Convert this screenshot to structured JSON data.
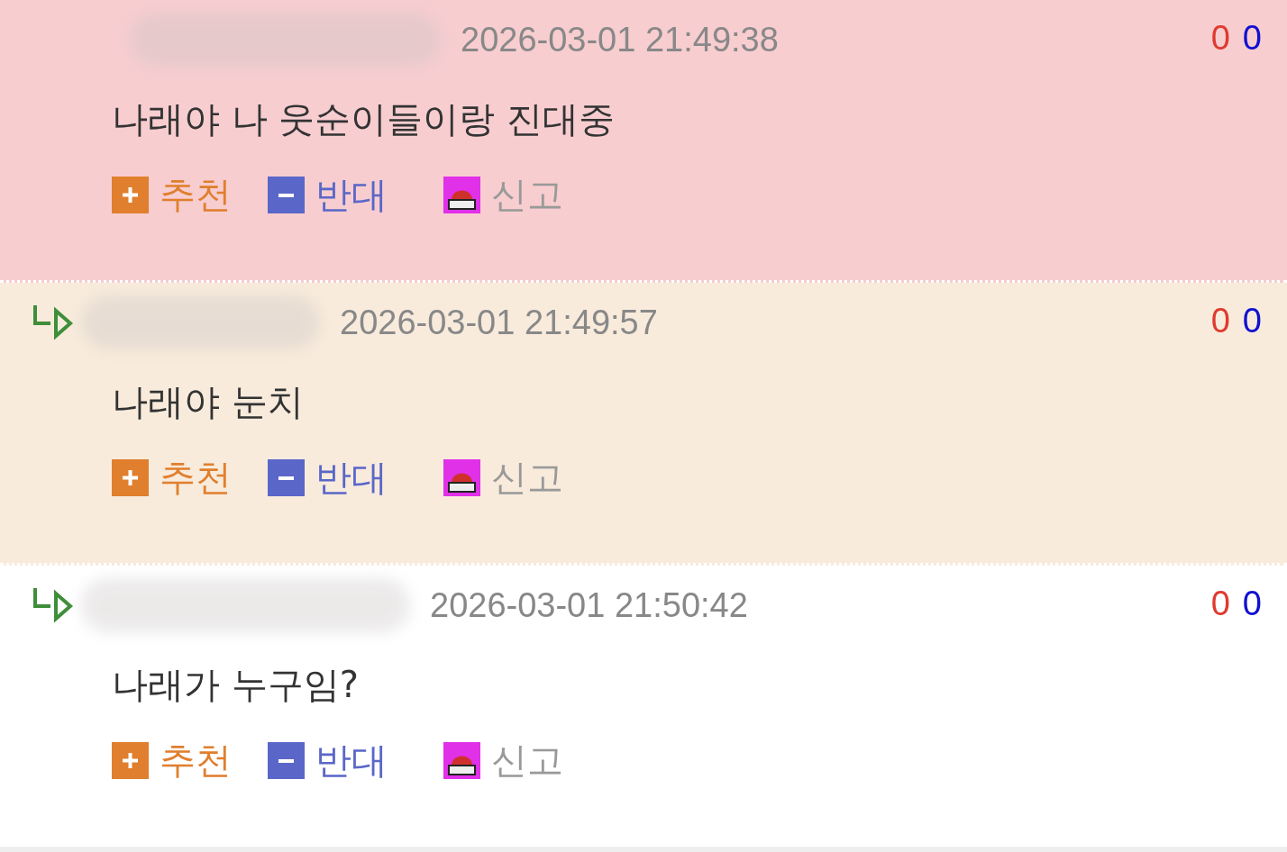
{
  "comments": [
    {
      "reply": false,
      "color": "#f7cdd0",
      "timestamp": "2026-03-01 21:49:38",
      "up_count": "0",
      "down_count": "0",
      "text": "나래야 나 웃순이들이랑 진대중",
      "actions": {
        "recommend": "추천",
        "oppose": "반대",
        "report": "신고"
      }
    },
    {
      "reply": true,
      "color": "#f8ebdc",
      "timestamp": "2026-03-01 21:49:57",
      "up_count": "0",
      "down_count": "0",
      "text": "나래야 눈치",
      "actions": {
        "recommend": "추천",
        "oppose": "반대",
        "report": "신고"
      }
    },
    {
      "reply": true,
      "color": "#ffffff",
      "timestamp": "2026-03-01 21:50:42",
      "up_count": "0",
      "down_count": "0",
      "text": "나래가 누구임?",
      "actions": {
        "recommend": "추천",
        "oppose": "반대",
        "report": "신고"
      }
    }
  ]
}
